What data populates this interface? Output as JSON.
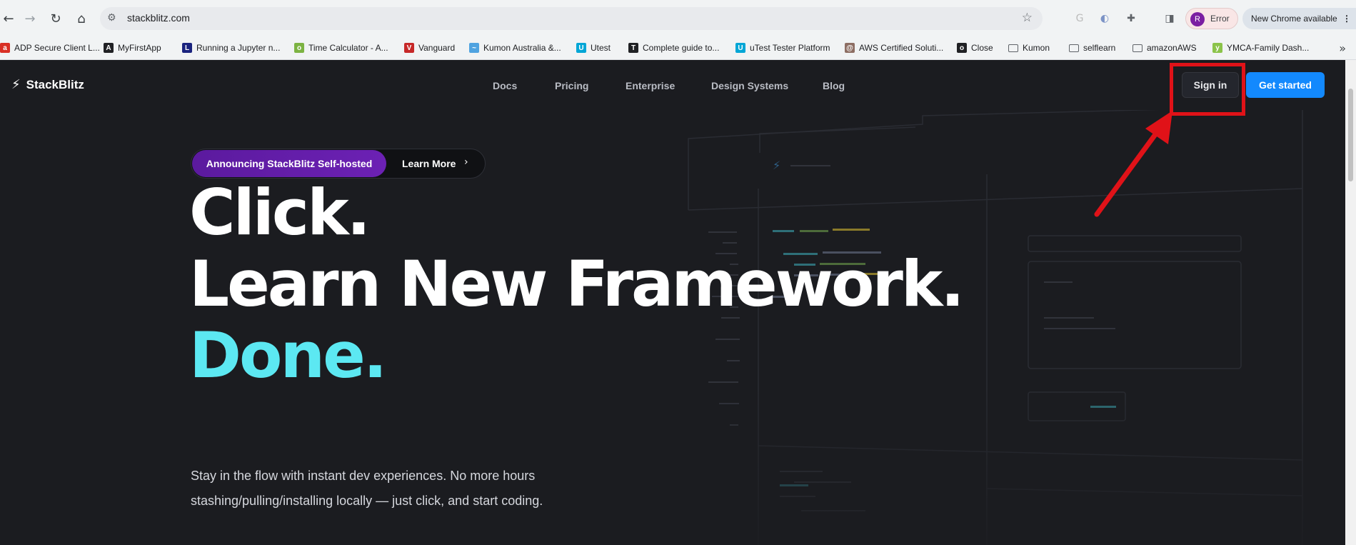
{
  "browser": {
    "url": "stackblitz.com",
    "profile": {
      "initial": "R",
      "status": "Error"
    },
    "update_label": "New Chrome available",
    "bookmarks": [
      {
        "label": "ADP Secure Client L...",
        "color": "#d93025",
        "glyph": "a"
      },
      {
        "label": "MyFirstApp",
        "color": "#202124",
        "glyph": "A"
      },
      {
        "label": "Running a Jupyter n...",
        "color": "#1a237e",
        "glyph": "L"
      },
      {
        "label": "Time Calculator - A...",
        "color": "#7cb342",
        "glyph": "o"
      },
      {
        "label": "Vanguard",
        "color": "#c62828",
        "glyph": "V"
      },
      {
        "label": "Kumon Australia &...",
        "color": "#4fa3e0",
        "glyph": "~"
      },
      {
        "label": "Utest",
        "color": "#00a6d6",
        "glyph": "U"
      },
      {
        "label": "Complete guide to...",
        "color": "#202124",
        "glyph": "T"
      },
      {
        "label": "uTest Tester Platform",
        "color": "#00a6d6",
        "glyph": "U"
      },
      {
        "label": "AWS Certified Soluti...",
        "color": "#8d6e63",
        "glyph": "@"
      },
      {
        "label": "Close",
        "color": "#202124",
        "glyph": "o"
      },
      {
        "label": "Kumon",
        "color": "#5f6368",
        "glyph": "folder"
      },
      {
        "label": "selflearn",
        "color": "#5f6368",
        "glyph": "folder"
      },
      {
        "label": "amazonAWS",
        "color": "#5f6368",
        "glyph": "folder"
      },
      {
        "label": "YMCA-Family Dash...",
        "color": "#8bc34a",
        "glyph": "y"
      }
    ]
  },
  "site": {
    "brand": "StackBlitz",
    "nav": [
      "Docs",
      "Pricing",
      "Enterprise",
      "Design Systems",
      "Blog"
    ],
    "signin_label": "Sign in",
    "get_started_label": "Get started",
    "announcement": {
      "pill": "Announcing StackBlitz Self-hosted",
      "link": "Learn More"
    },
    "hero": {
      "line1": "Click.",
      "line2": "Learn New Framework.",
      "line3": "Done."
    },
    "subtext": {
      "line1": "Stay in the flow with instant dev experiences. No more hours",
      "line2": "stashing/pulling/installing locally — just click, and start coding."
    },
    "colors": {
      "accent_cyan": "#5ce8f2",
      "primary_blue": "#1389fd",
      "announce_purple": "#6c21b4"
    }
  },
  "annotation": {
    "color": "#e01218",
    "target": "signin-button"
  }
}
